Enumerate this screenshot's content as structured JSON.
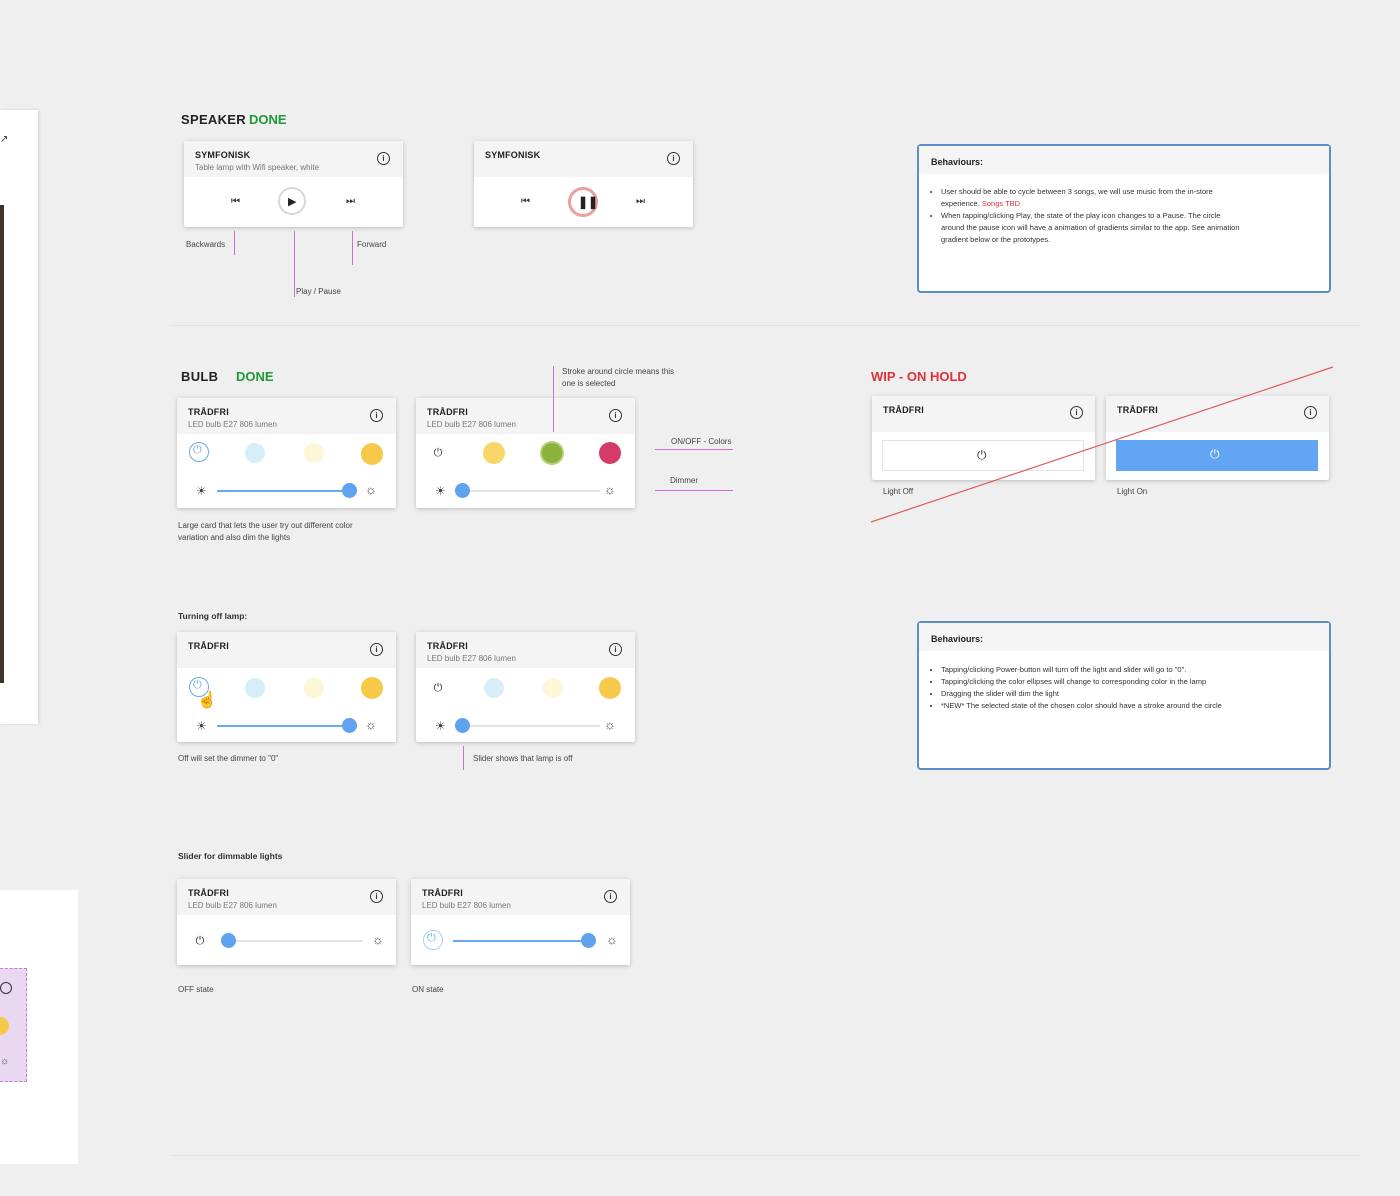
{
  "speaker": {
    "title": "SPEAKER",
    "status": "DONE",
    "card1": {
      "title": "SYMFONISK",
      "subtitle": "Table lamp with Wifi speaker, white"
    },
    "card2": {
      "title": "SYMFONISK"
    },
    "annotations": {
      "backwards": "Backwards",
      "play_pause": "Play / Pause",
      "forward": "Forward"
    },
    "behaviours": {
      "title": "Behaviours:",
      "item1a": "User should be able to cycle between 3 songs, we will use music from the in-store experience.",
      "item1b": "Songs TBD",
      "item2": "When tapping/clicking Play, the state of the play icon changes to a Pause. The circle around the pause icon will have a animation of gradients similar to the app. See animation gradient below or the prototypes."
    }
  },
  "bulb": {
    "title": "BULB",
    "status": "DONE",
    "card1": {
      "title": "TRÅDFRI",
      "subtitle": "LED bulb E27 806 lumen"
    },
    "card2": {
      "title": "TRÅDFRI",
      "subtitle": "LED bulb E27 806 lumen"
    },
    "note_large_card": "Large card that lets the user try out different color variation and also dim the lights",
    "annotations": {
      "stroke": "Stroke around circle means this one is selected",
      "onoff_colors": "ON/OFF - Colors",
      "dimmer": "Dimmer"
    }
  },
  "wip": {
    "title": "WIP - ON HOLD",
    "card_off": {
      "title": "TRÅDFRI",
      "label": "Light Off"
    },
    "card_on": {
      "title": "TRÅDFRI",
      "label": "Light On"
    }
  },
  "turning_off": {
    "heading": "Turning off lamp:",
    "card1": {
      "title": "TRÅDFRI"
    },
    "card2": {
      "title": "TRÅDFRI",
      "subtitle": "LED bulb E27 806 lumen"
    },
    "note_left": "Off will set the dimmer to \"0\"",
    "note_right": "Slider shows that lamp is off",
    "behaviours": {
      "title": "Behaviours:",
      "items": [
        "Tapping/clicking Power-button will turn off the light and slider will go to \"0\".",
        "Tapping/clicking the color ellipses will change to corresponding color in the lamp",
        "Dragging the slider will dim the light",
        "*NEW* The selected state of the chosen color should have a stroke around the circle"
      ]
    }
  },
  "dimmable": {
    "heading": "Slider for dimmable lights",
    "card1": {
      "title": "TRÅDFRI",
      "subtitle": "LED bulb E27 806 lumen",
      "state": "OFF state",
      "level": 0
    },
    "card2": {
      "title": "TRÅDFRI",
      "subtitle": "LED bulb E27 806 lumen",
      "state": "ON state",
      "level": 1
    }
  },
  "colors": {
    "accent": "#5fa2ee",
    "done": "#1f9a3a",
    "wip": "#e0303a",
    "annotation": "#d66bd6",
    "yellow": "#f7c948",
    "green": "#8bb23a",
    "crimson": "#d63a68",
    "lightblue": "#d6eefa",
    "lightyellow": "#fdf7d8"
  }
}
